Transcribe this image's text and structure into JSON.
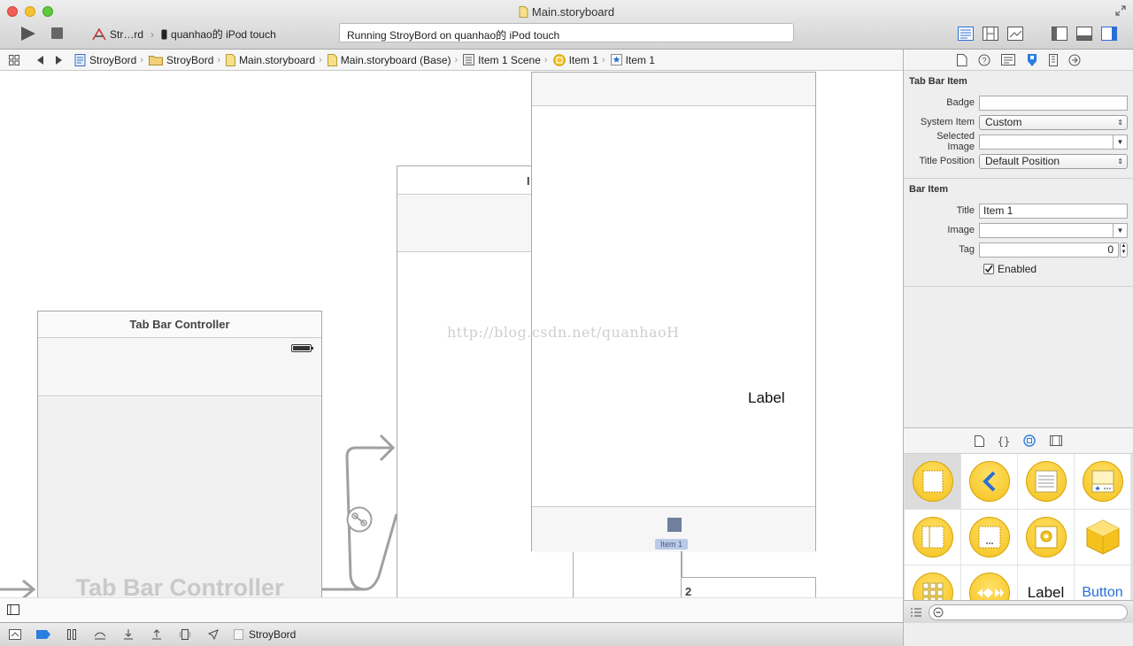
{
  "window": {
    "title": "Main.storyboard"
  },
  "toolbar": {
    "scheme_name": "Str…rd",
    "device_name": "quanhao的 iPod touch",
    "activity_status": "Running StroyBord on quanhao的 iPod touch"
  },
  "jumpbar": {
    "crumbs": [
      {
        "label": "StroyBord",
        "icon": "project-icon"
      },
      {
        "label": "StroyBord",
        "icon": "folder-icon"
      },
      {
        "label": "Main.storyboard",
        "icon": "storyboard-file-icon"
      },
      {
        "label": "Main.storyboard (Base)",
        "icon": "storyboard-file-icon"
      },
      {
        "label": "Item 1 Scene",
        "icon": "scene-icon"
      },
      {
        "label": "Item 1",
        "icon": "view-controller-icon"
      },
      {
        "label": "Item 1",
        "icon": "tab-bar-item-icon"
      }
    ]
  },
  "canvas": {
    "tab_bar_controller": {
      "title": "Tab Bar Controller",
      "watermark_label": "Tab Bar Controller"
    },
    "middle_scene": {
      "title_fragment": "I"
    },
    "item_scene": {
      "label_text": "Label",
      "tab_item_label": "Item 1"
    },
    "bottom_scene": {
      "title_fragment": "2"
    },
    "watermark_text": "http://blog.csdn.net/quanhaoH"
  },
  "inspector": {
    "tab_bar_item_section": {
      "title": "Tab Bar Item",
      "badge_label": "Badge",
      "badge_value": "",
      "system_item_label": "System Item",
      "system_item_value": "Custom",
      "selected_image_label": "Selected Image",
      "selected_image_value": "",
      "title_position_label": "Title Position",
      "title_position_value": "Default Position"
    },
    "bar_item_section": {
      "title": "Bar Item",
      "title_label": "Title",
      "title_value": "Item 1",
      "image_label": "Image",
      "image_value": "",
      "tag_label": "Tag",
      "tag_value": "0",
      "enabled_label": "Enabled",
      "enabled_checked": true
    },
    "library": {
      "items": [
        {
          "icon": "view-controller-object-icon"
        },
        {
          "icon": "navigation-controller-object-icon"
        },
        {
          "icon": "table-view-controller-object-icon"
        },
        {
          "icon": "tab-bar-controller-object-icon"
        },
        {
          "icon": "split-view-controller-object-icon"
        },
        {
          "icon": "page-view-controller-object-icon"
        },
        {
          "icon": "glkit-view-controller-object-icon"
        },
        {
          "icon": "object-cube-icon"
        },
        {
          "icon": "collection-view-controller-object-icon"
        },
        {
          "icon": "av-player-view-controller-object-icon"
        },
        {
          "text": "Label"
        },
        {
          "text": "Button"
        }
      ]
    }
  },
  "debugbar": {
    "target_label": "StroyBord"
  }
}
